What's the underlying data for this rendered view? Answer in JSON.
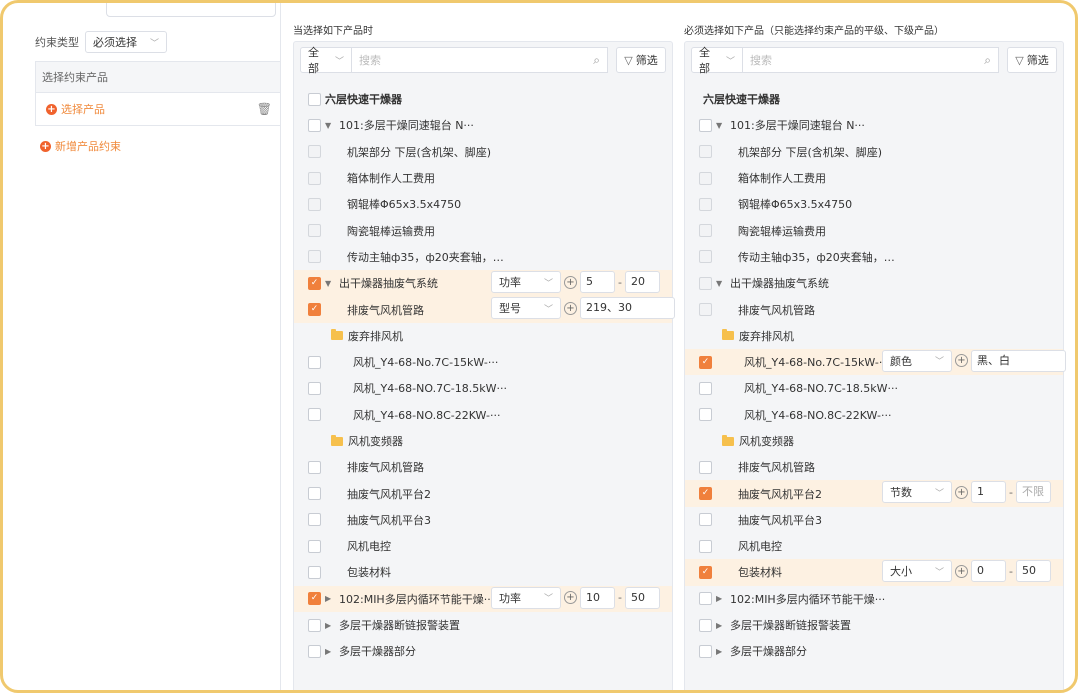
{
  "left": {
    "constraint_type_label": "约束类型",
    "constraint_type_value": "必须选择",
    "table_header": "选择约束产品",
    "select_product": "选择产品",
    "add_constraint": "新增产品约束"
  },
  "panelA": {
    "title": "当选择如下产品时",
    "all": "全部",
    "search_placeholder": "搜索",
    "filter": "筛选",
    "rows": [
      {
        "label": "六层快速干燥器",
        "bold": true,
        "indent": 0,
        "check": "empty"
      },
      {
        "label": "101:多层干燥同速辊台 N···",
        "tri": "down",
        "indent": 0,
        "check": "empty"
      },
      {
        "label": "机架部分 下层(含机架、脚座)",
        "indent": 1,
        "check": "dim"
      },
      {
        "label": "箱体制作人工费用",
        "indent": 1,
        "check": "dim"
      },
      {
        "label": "钢辊棒Φ65x3.5x4750",
        "indent": 1,
        "check": "dim"
      },
      {
        "label": "陶瓷辊棒运输费用",
        "indent": 1,
        "check": "dim"
      },
      {
        "label": "传动主轴ф35，ф20夹套轴，…",
        "indent": 1,
        "check": "dim"
      },
      {
        "label": "出干燥器抽废气系统",
        "tri": "down",
        "indent": 0,
        "check": "checked",
        "hl": true,
        "ctrl": {
          "sel": "功率",
          "a": "5",
          "b": "20"
        }
      },
      {
        "label": "排废气风机管路",
        "indent": 1,
        "check": "checked",
        "hl": true,
        "ctrl": {
          "sel": "型号",
          "v": "219、30"
        }
      },
      {
        "label": "废弃排风机",
        "folder": true,
        "indent": 1
      },
      {
        "label": "风机_Y4-68-No.7C-15kW-···",
        "indent": 2,
        "check": "empty"
      },
      {
        "label": "风机_Y4-68-NO.7C-18.5kW···",
        "indent": 2,
        "check": "empty"
      },
      {
        "label": "风机_Y4-68-NO.8C-22KW-···",
        "indent": 2,
        "check": "empty"
      },
      {
        "label": "风机变频器",
        "folder": true,
        "indent": 1
      },
      {
        "label": "排废气风机管路",
        "indent": 1,
        "check": "empty"
      },
      {
        "label": "抽废气风机平台2",
        "indent": 1,
        "check": "empty"
      },
      {
        "label": "抽废气风机平台3",
        "indent": 1,
        "check": "empty"
      },
      {
        "label": "风机电控",
        "indent": 1,
        "check": "empty"
      },
      {
        "label": "包装材料",
        "indent": 1,
        "check": "empty"
      },
      {
        "label": "102:MIH多层内循环节能干燥···",
        "tri": "right",
        "indent": 0,
        "check": "checked",
        "hl": true,
        "ctrl": {
          "sel": "功率",
          "a": "10",
          "b": "50"
        }
      },
      {
        "label": "多层干燥器断链报警装置",
        "tri": "right",
        "indent": 0,
        "check": "empty"
      },
      {
        "label": "多层干燥器部分",
        "tri": "right",
        "indent": 0,
        "check": "empty"
      }
    ]
  },
  "panelB": {
    "title": "必须选择如下产品（只能选择约束产品的平级、下级产品）",
    "all": "全部",
    "search_placeholder": "搜索",
    "filter": "筛选",
    "rows": [
      {
        "label": "六层快速干燥器",
        "bold": true,
        "indent": 0
      },
      {
        "label": "101:多层干燥同速辊台 N···",
        "tri": "down",
        "indent": 0,
        "check": "empty"
      },
      {
        "label": "机架部分 下层(含机架、脚座)",
        "indent": 1,
        "check": "dim"
      },
      {
        "label": "箱体制作人工费用",
        "indent": 1,
        "check": "dim"
      },
      {
        "label": "钢辊棒Φ65x3.5x4750",
        "indent": 1,
        "check": "dim"
      },
      {
        "label": "陶瓷辊棒运输费用",
        "indent": 1,
        "check": "dim"
      },
      {
        "label": "传动主轴ф35，ф20夹套轴，…",
        "indent": 1,
        "check": "dim"
      },
      {
        "label": "出干燥器抽废气系统",
        "tri": "down",
        "indent": 0,
        "check": "dim"
      },
      {
        "label": "排废气风机管路",
        "indent": 1,
        "check": "dim"
      },
      {
        "label": "废弃排风机",
        "folder": true,
        "indent": 1
      },
      {
        "label": "风机_Y4-68-No.7C-15kW-···",
        "indent": 2,
        "check": "checked",
        "hl": true,
        "ctrl": {
          "sel": "颜色",
          "v": "黑、白"
        }
      },
      {
        "label": "风机_Y4-68-NO.7C-18.5kW···",
        "indent": 2,
        "check": "empty"
      },
      {
        "label": "风机_Y4-68-NO.8C-22KW-···",
        "indent": 2,
        "check": "empty"
      },
      {
        "label": "风机变频器",
        "folder": true,
        "indent": 1
      },
      {
        "label": "排废气风机管路",
        "indent": 1,
        "check": "empty"
      },
      {
        "label": "抽废气风机平台2",
        "indent": 1,
        "check": "checked",
        "hl": true,
        "ctrl": {
          "sel": "节数",
          "a": "1",
          "b": "不限",
          "bph": true
        }
      },
      {
        "label": "抽废气风机平台3",
        "indent": 1,
        "check": "empty"
      },
      {
        "label": "风机电控",
        "indent": 1,
        "check": "empty"
      },
      {
        "label": "包装材料",
        "indent": 1,
        "check": "checked",
        "hl": true,
        "ctrl": {
          "sel": "大小",
          "a": "0",
          "b": "50"
        }
      },
      {
        "label": "102:MIH多层内循环节能干燥···",
        "tri": "right",
        "indent": 0,
        "check": "empty"
      },
      {
        "label": "多层干燥器断链报警装置",
        "tri": "right",
        "indent": 0,
        "check": "empty"
      },
      {
        "label": "多层干燥器部分",
        "tri": "right",
        "indent": 0,
        "check": "empty"
      }
    ]
  },
  "colors": {
    "accent": "#f0803c",
    "frame": "#f0c96e",
    "highlight": "#fdf1e2"
  }
}
